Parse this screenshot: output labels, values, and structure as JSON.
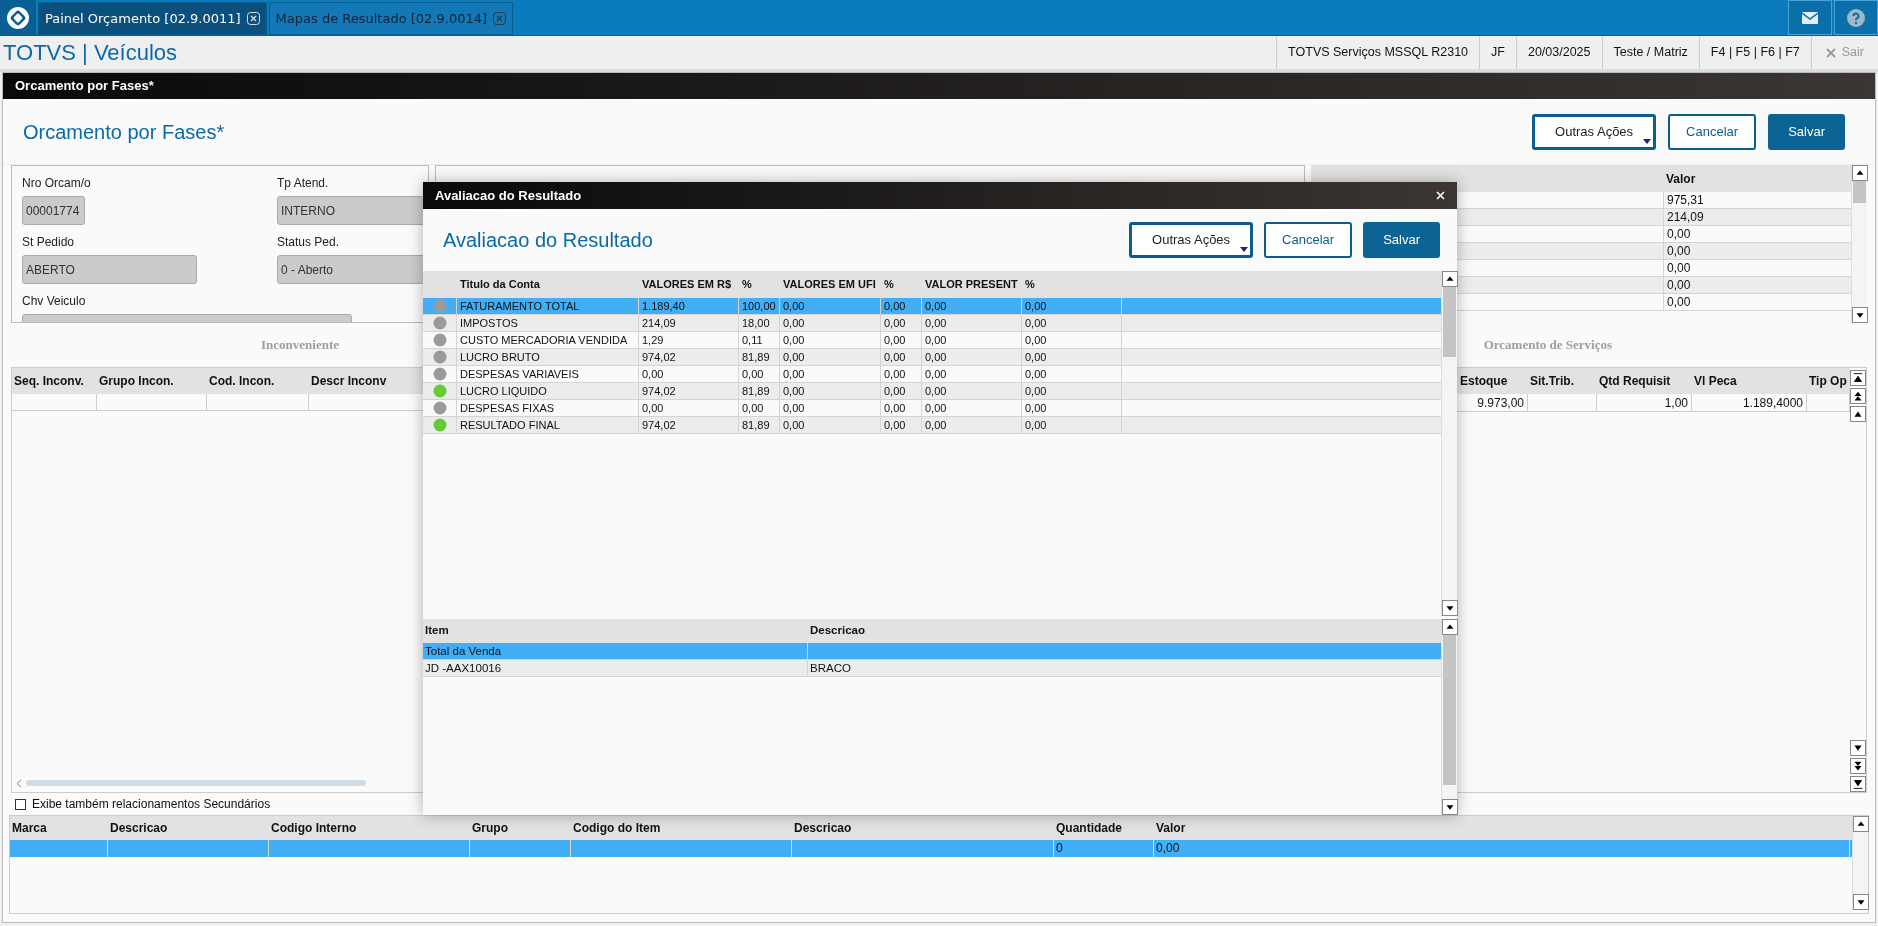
{
  "top_tabs": [
    {
      "label": "Painel Orçamento [02.9.0011]",
      "selected": true
    },
    {
      "label": "Mapas de Resultado [02.9.0014]",
      "selected": false
    }
  ],
  "app_title": "TOTVS | Veículos",
  "status_items": [
    "TOTVS Serviços MSSQL R2310",
    "JF",
    "20/03/2025",
    "Teste / Matriz",
    "F4 | F5 | F6 | F7"
  ],
  "exit_button": {
    "label": "Sair",
    "disabled": true
  },
  "window": {
    "title": "Orcamento por Fases*",
    "heading": "Orcamento por Fases*",
    "buttons": [
      {
        "label": "Outras Ações",
        "kind": "menu"
      },
      {
        "label": "Cancelar",
        "kind": "secondary"
      },
      {
        "label": "Salvar",
        "kind": "primary"
      }
    ]
  },
  "form_fields": [
    {
      "label": "Nro Orcam/o",
      "value": "00001774"
    },
    {
      "label": "Tp Atend.",
      "value": "INTERNO"
    },
    {
      "label": "St Pedido",
      "value": "ABERTO"
    },
    {
      "label": "Status Ped.",
      "value": "0 - Aberto"
    },
    {
      "label": "Chv Veiculo"
    }
  ],
  "summary_table": {
    "value_column": "Valor",
    "rows": [
      "975,31",
      "214,09",
      "0,00",
      "0,00",
      "0,00",
      "0,00",
      "0,00"
    ]
  },
  "inconveniente_grid": {
    "title": "Inconveniente",
    "columns": [
      "Seq. Inconv.",
      "Grupo Incon.",
      "Cod. Incon.",
      "Descr Inconv"
    ]
  },
  "servicos_grid": {
    "title": "Orcamento de Serviços",
    "columns": [
      "Estoque",
      "Sit.Trib.",
      "Qtd Requisit",
      "Vl Peca",
      "Tip Op"
    ],
    "rows": [
      {
        "estoque": "9.973,00",
        "qtd_requisit": "1,00",
        "vl_peca": "1.189,4000"
      }
    ]
  },
  "secondary_checkbox": {
    "label": "Exibe também relacionamentos Secundários",
    "checked": false
  },
  "items_grid": {
    "columns": [
      "Marca",
      "Descricao",
      "Codigo Interno",
      "Grupo",
      "Codigo do Item",
      "Descricao",
      "Quantidade",
      "Valor"
    ],
    "rows": [
      {
        "selected": true,
        "quantidade": "0",
        "valor": "0,00"
      }
    ]
  },
  "dialog": {
    "title": "Avaliacao do Resultado",
    "heading": "Avaliacao do Resultado",
    "buttons": [
      {
        "label": "Outras Ações",
        "kind": "menu"
      },
      {
        "label": "Cancelar",
        "kind": "secondary"
      },
      {
        "label": "Salvar",
        "kind": "primary"
      }
    ],
    "result_table": {
      "columns": [
        "Titulo da Conta",
        "VALORES EM R$",
        "%",
        "VALORES EM UFI",
        "%",
        "VALOR PRESENT",
        "%"
      ],
      "rows": [
        {
          "color": "#9a9a9a",
          "selected": true,
          "cells": [
            "FATURAMENTO TOTAL",
            "1.189,40",
            "100,00",
            "0,00",
            "0,00",
            "0,00",
            "0,00"
          ]
        },
        {
          "color": "#9a9a9a",
          "selected": false,
          "cells": [
            "IMPOSTOS",
            "214,09",
            "18,00",
            "0,00",
            "0,00",
            "0,00",
            "0,00"
          ]
        },
        {
          "color": "#9a9a9a",
          "selected": false,
          "cells": [
            "CUSTO MERCADORIA VENDIDA",
            "1,29",
            "0,11",
            "0,00",
            "0,00",
            "0,00",
            "0,00"
          ]
        },
        {
          "color": "#9a9a9a",
          "selected": false,
          "cells": [
            "LUCRO BRUTO",
            "974,02",
            "81,89",
            "0,00",
            "0,00",
            "0,00",
            "0,00"
          ]
        },
        {
          "color": "#9a9a9a",
          "selected": false,
          "cells": [
            "DESPESAS VARIAVEIS",
            "0,00",
            "0,00",
            "0,00",
            "0,00",
            "0,00",
            "0,00"
          ]
        },
        {
          "color": "#66cc33",
          "selected": false,
          "cells": [
            "LUCRO LIQUIDO",
            "974,02",
            "81,89",
            "0,00",
            "0,00",
            "0,00",
            "0,00"
          ]
        },
        {
          "color": "#9a9a9a",
          "selected": false,
          "cells": [
            "DESPESAS FIXAS",
            "0,00",
            "0,00",
            "0,00",
            "0,00",
            "0,00",
            "0,00"
          ]
        },
        {
          "color": "#66cc33",
          "selected": false,
          "cells": [
            "RESULTADO FINAL",
            "974,02",
            "81,89",
            "0,00",
            "0,00",
            "0,00",
            "0,00"
          ]
        }
      ]
    },
    "items_table": {
      "columns": [
        "Item",
        "Descricao"
      ],
      "rows": [
        {
          "selected": true,
          "item": "Total da Venda"
        },
        {
          "selected": false,
          "item": "JD -AAX10016",
          "descricao": "BRACO"
        }
      ]
    }
  }
}
